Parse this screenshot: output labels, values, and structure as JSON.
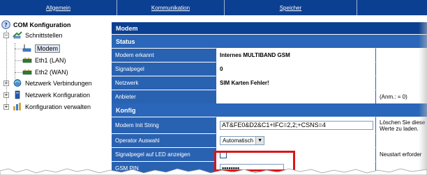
{
  "top_nav": {
    "tabs": [
      "Allgemein",
      "Kommunikation",
      "Speicher",
      ""
    ]
  },
  "tree": {
    "root": "COM Konfiguration",
    "items": [
      {
        "label": "Schnittstellen",
        "expanded": true,
        "icon": "network-interfaces-icon"
      },
      {
        "label": "Modem",
        "selected": true,
        "icon": "modem-icon"
      },
      {
        "label": "Eth1 (LAN)",
        "icon": "ethernet-icon"
      },
      {
        "label": "Eth2 (WAN)",
        "icon": "ethernet-icon"
      },
      {
        "label": "Netzwerk Verbindungen",
        "icon": "network-connections-icon"
      },
      {
        "label": "Netzwerk Konfiguration",
        "icon": "network-config-icon"
      },
      {
        "label": "Konfiguration verwalten",
        "icon": "config-manage-icon"
      }
    ]
  },
  "panel": {
    "title": "Modem",
    "status": {
      "heading": "Status",
      "rows": [
        {
          "label": "Modem erkannt",
          "value": "Internes MULTIBAND GSM",
          "note": ""
        },
        {
          "label": "Signalpegel",
          "value": "0",
          "note": ""
        },
        {
          "label": "Netzwerk",
          "value": "SIM Karten Fehler!",
          "note": ""
        },
        {
          "label": "Anbieter",
          "value": "",
          "note": "(Anm.: = 0)"
        }
      ]
    },
    "config": {
      "heading": "Konfig",
      "init_label": "Modem Init String",
      "init_value": "AT&FE0&D2&C1+IFC=2,2;+CSNS=4",
      "init_note": "Löschen Sie diese Werte zu laden.",
      "operator_label": "Operator Auswahl",
      "operator_value": "Automatisch",
      "led_label": "Signalpegel auf LED anzeigen",
      "led_note": "Neustart erforder",
      "pin_label": "GSM PIN",
      "pin_value": "••••••••"
    }
  },
  "colors": {
    "nav_bg": "#0b3f92",
    "section_bg": "#2a66b9",
    "label_cell_bg": "#2a62b2",
    "highlight": "#d9151a"
  }
}
